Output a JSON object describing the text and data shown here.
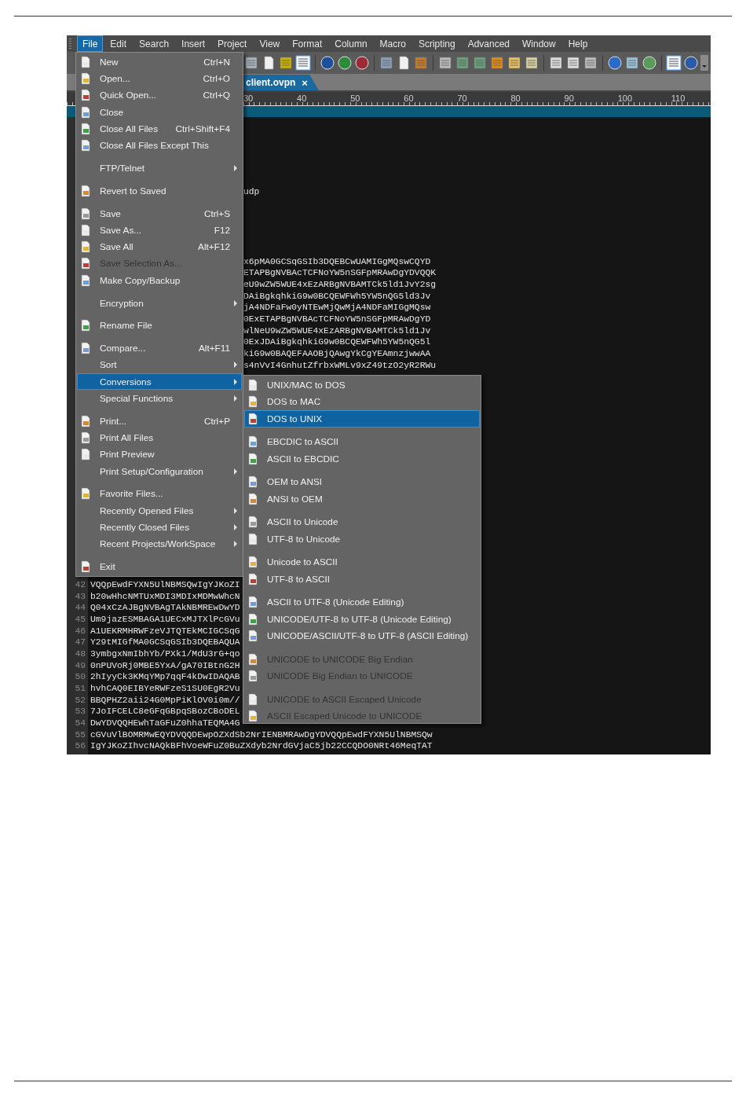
{
  "menubar": [
    {
      "label": "File",
      "selected": true
    },
    {
      "label": "Edit",
      "selected": false
    },
    {
      "label": "Search",
      "selected": false
    },
    {
      "label": "Insert",
      "selected": false
    },
    {
      "label": "Project",
      "selected": false
    },
    {
      "label": "View",
      "selected": false
    },
    {
      "label": "Format",
      "selected": false
    },
    {
      "label": "Column",
      "selected": false
    },
    {
      "label": "Macro",
      "selected": false
    },
    {
      "label": "Scripting",
      "selected": false
    },
    {
      "label": "Advanced",
      "selected": false
    },
    {
      "label": "Window",
      "selected": false
    },
    {
      "label": "Help",
      "selected": false
    }
  ],
  "tabs": [
    {
      "label": "client.ovpn",
      "close": "×",
      "selected": true
    }
  ],
  "ruler": {
    "labels": [
      "30",
      "40",
      "50",
      "60",
      "70",
      "80",
      "90",
      "100",
      "110"
    ]
  },
  "editor": {
    "lines": [
      {
        "kind": "blank"
      },
      {
        "kind": "blank"
      },
      {
        "kind": "blank"
      },
      {
        "kind": "blank"
      },
      {
        "kind": "blank"
      },
      {
        "kind": "blank"
      },
      {
        "kind": "partial",
        "text": "udp"
      },
      {
        "kind": "blank"
      },
      {
        "kind": "blank"
      },
      {
        "kind": "blank"
      },
      {
        "kind": "blank"
      },
      {
        "kind": "blank"
      },
      {
        "kind": "partial",
        "text": "x6pMA0GCSqGSIb3DQEBCwUAMIGgMQswCQYD"
      },
      {
        "kind": "partial",
        "text": "ETAPBgNVBAcTCFNoYW5nSGFpMRAwDgYDVQQK"
      },
      {
        "kind": "partial",
        "text": "eU9wZW5WUE4xEzARBgNVBAMTCk5ld1JvY2sg"
      },
      {
        "kind": "partial",
        "text": "DAiBgkqhkiG9w0BCQEWFWh5YW5nQG5ld3Jv"
      },
      {
        "kind": "partial",
        "text": "jA4NDFaFw0yNTEwMjQwMjA4NDFaMIGgMQsw"
      },
      {
        "kind": "partial",
        "text": "0ExETAPBgNVBAcTCFNoYW5nSGFpMRAwDgYD"
      },
      {
        "kind": "partial",
        "text": "wlNeU9wZW5WUE4xEzARBgNVBAMTCk5ld1Jv"
      },
      {
        "kind": "partial",
        "text": "0ExJDAiBgkqhkiG9w0BCQEWFWh5YW5nQG5l"
      },
      {
        "kind": "partial",
        "text": "kiG9w0BAQEFAAOBjQAwgYkCgYEAmnzjwwAA"
      },
      {
        "kind": "partial",
        "text": "s4nVvI4GnhutZfrbxWMLv9xZ49tzO2yR2RWu"
      },
      {
        "kind": "blank"
      },
      {
        "kind": "blank"
      },
      {
        "kind": "blank"
      },
      {
        "kind": "blank"
      },
      {
        "kind": "blank"
      },
      {
        "kind": "blank"
      },
      {
        "kind": "blank"
      },
      {
        "kind": "blank"
      },
      {
        "kind": "blank"
      },
      {
        "kind": "blank"
      },
      {
        "kind": "blank"
      },
      {
        "kind": "blank"
      },
      {
        "kind": "blank"
      },
      {
        "kind": "blank"
      },
      {
        "kind": "blank"
      },
      {
        "kind": "blank"
      },
      {
        "kind": "blank"
      },
      {
        "kind": "blank"
      },
      {
        "kind": "numbered",
        "number": "42",
        "text": "VQQpEwdFYXN5UlNBMSQwIgYJKoZI"
      },
      {
        "kind": "numbered",
        "number": "43",
        "text": "b20wHhcNMTUxMDI3MDIxMDMwWhcN"
      },
      {
        "kind": "numbered",
        "number": "44",
        "text": "Q04xCzAJBgNVBAgTAkNBMREwDwYD"
      },
      {
        "kind": "numbered",
        "number": "45",
        "text": "Um9jazESMBAGA1UECxMJTXlPcGVu"
      },
      {
        "kind": "numbered",
        "number": "46",
        "text": "A1UEKRMHRWFzeVJTQTEkMCIGCSqG"
      },
      {
        "kind": "numbered",
        "number": "47",
        "text": "Y29tMIGfMA0GCSqGSIb3DQEBAQUA"
      },
      {
        "kind": "numbered",
        "number": "48",
        "text": "3ymbgxNmIbhYb/PXk1/MdU3rG+qo"
      },
      {
        "kind": "numbered",
        "number": "49",
        "text": "0nPUVoRj0MBE5YxA/gA70IBtnG2H"
      },
      {
        "kind": "numbered",
        "number": "50",
        "text": "2hIyyCk3KMqYMp7qqF4kDwIDAQAB"
      },
      {
        "kind": "numbered",
        "number": "51",
        "text": "hvhCAQ0EIBYeRWFzeS1SU0EgR2Vu"
      },
      {
        "kind": "numbered",
        "number": "52",
        "text": "BBQPHZ2aii24G0MpPiKlOV0i0m//"
      },
      {
        "kind": "numbered",
        "number": "53",
        "text": "7JoIFCELC8eGFqGBpqSBozCBoDEL"
      },
      {
        "kind": "numbered",
        "number": "54",
        "text": "DwYDVQQHEwhTaGFuZ0hhaTEQMA4G"
      },
      {
        "kind": "numbered",
        "number": "55",
        "text": "cGVuVlBOMRMwEQYDVQQDEwpOZXdSb2NrIENBMRAwDgYDVQQpEwdFYXN5UlNBMSQw"
      },
      {
        "kind": "numbered",
        "number": "56",
        "text": "IgYJKoZIhvcNAQkBFhVoeWFuZ0BuZXdyb2NrdGVjaC5jb22CCQDO0NRt46MeqTAT"
      }
    ]
  },
  "file_menu": {
    "items": [
      {
        "kind": "item",
        "label": "New",
        "shortcut": "Ctrl+N",
        "icon": true,
        "submenu": false,
        "disabled": false,
        "selected": false
      },
      {
        "kind": "item",
        "label": "Open...",
        "shortcut": "Ctrl+O",
        "icon": true,
        "submenu": false,
        "disabled": false,
        "selected": false
      },
      {
        "kind": "item",
        "label": "Quick Open...",
        "shortcut": "Ctrl+Q",
        "icon": true,
        "submenu": false,
        "disabled": false,
        "selected": false
      },
      {
        "kind": "item",
        "label": "Close",
        "icon": true,
        "submenu": false,
        "disabled": false,
        "selected": false
      },
      {
        "kind": "item",
        "label": "Close All Files",
        "shortcut": "Ctrl+Shift+F4",
        "icon": true,
        "submenu": false,
        "disabled": false,
        "selected": false
      },
      {
        "kind": "item",
        "label": "Close All Files Except This",
        "icon": true,
        "submenu": false,
        "disabled": false,
        "selected": false
      },
      {
        "kind": "separator"
      },
      {
        "kind": "item",
        "label": "FTP/Telnet",
        "icon": false,
        "submenu": true,
        "disabled": false,
        "selected": false
      },
      {
        "kind": "separator"
      },
      {
        "kind": "item",
        "label": "Revert to Saved",
        "icon": true,
        "submenu": false,
        "disabled": false,
        "selected": false
      },
      {
        "kind": "separator"
      },
      {
        "kind": "item",
        "label": "Save",
        "shortcut": "Ctrl+S",
        "icon": true,
        "submenu": false,
        "disabled": false,
        "selected": false
      },
      {
        "kind": "item",
        "label": "Save As...",
        "shortcut": "F12",
        "icon": true,
        "submenu": false,
        "disabled": false,
        "selected": false
      },
      {
        "kind": "item",
        "label": "Save All",
        "shortcut": "Alt+F12",
        "icon": true,
        "submenu": false,
        "disabled": false,
        "selected": false
      },
      {
        "kind": "item",
        "label": "Save Selection As...",
        "icon": true,
        "submenu": false,
        "disabled": true,
        "selected": false
      },
      {
        "kind": "item",
        "label": "Make Copy/Backup",
        "icon": true,
        "submenu": false,
        "disabled": false,
        "selected": false
      },
      {
        "kind": "separator"
      },
      {
        "kind": "item",
        "label": "Encryption",
        "icon": false,
        "submenu": true,
        "disabled": false,
        "selected": false
      },
      {
        "kind": "separator"
      },
      {
        "kind": "item",
        "label": "Rename File",
        "icon": true,
        "submenu": false,
        "disabled": false,
        "selected": false
      },
      {
        "kind": "separator"
      },
      {
        "kind": "item",
        "label": "Compare...",
        "shortcut": "Alt+F11",
        "icon": true,
        "submenu": false,
        "disabled": false,
        "selected": false
      },
      {
        "kind": "item",
        "label": "Sort",
        "icon": false,
        "submenu": true,
        "disabled": false,
        "selected": false
      },
      {
        "kind": "item",
        "label": "Conversions",
        "icon": false,
        "submenu": true,
        "disabled": false,
        "selected": true
      },
      {
        "kind": "item",
        "label": "Special Functions",
        "icon": false,
        "submenu": true,
        "disabled": false,
        "selected": false
      },
      {
        "kind": "separator"
      },
      {
        "kind": "item",
        "label": "Print...",
        "shortcut": "Ctrl+P",
        "icon": true,
        "submenu": false,
        "disabled": false,
        "selected": false
      },
      {
        "kind": "item",
        "label": "Print All Files",
        "icon": true,
        "submenu": false,
        "disabled": false,
        "selected": false
      },
      {
        "kind": "item",
        "label": "Print Preview",
        "icon": true,
        "submenu": false,
        "disabled": false,
        "selected": false
      },
      {
        "kind": "item",
        "label": "Print Setup/Configuration",
        "icon": false,
        "submenu": true,
        "disabled": false,
        "selected": false
      },
      {
        "kind": "separator"
      },
      {
        "kind": "item",
        "label": "Favorite Files...",
        "icon": true,
        "submenu": false,
        "disabled": false,
        "selected": false
      },
      {
        "kind": "item",
        "label": "Recently Opened Files",
        "icon": false,
        "submenu": true,
        "disabled": false,
        "selected": false
      },
      {
        "kind": "item",
        "label": "Recently Closed Files",
        "icon": false,
        "submenu": true,
        "disabled": false,
        "selected": false
      },
      {
        "kind": "item",
        "label": "Recent Projects/WorkSpace",
        "icon": false,
        "submenu": true,
        "disabled": false,
        "selected": false
      },
      {
        "kind": "separator"
      },
      {
        "kind": "item",
        "label": "Exit",
        "icon": true,
        "submenu": false,
        "disabled": false,
        "selected": false
      }
    ]
  },
  "conversions_menu": {
    "items": [
      {
        "kind": "item",
        "label": "UNIX/MAC to DOS",
        "icon": true,
        "submenu": false,
        "disabled": false,
        "selected": false
      },
      {
        "kind": "item",
        "label": "DOS to MAC",
        "icon": true,
        "submenu": false,
        "disabled": false,
        "selected": false
      },
      {
        "kind": "item",
        "label": "DOS to UNIX",
        "icon": true,
        "submenu": false,
        "disabled": false,
        "selected": true
      },
      {
        "kind": "separator"
      },
      {
        "kind": "item",
        "label": "EBCDIC to ASCII",
        "icon": true,
        "submenu": false,
        "disabled": false,
        "selected": false
      },
      {
        "kind": "item",
        "label": "ASCII to EBCDIC",
        "icon": true,
        "submenu": false,
        "disabled": false,
        "selected": false
      },
      {
        "kind": "separator"
      },
      {
        "kind": "item",
        "label": "OEM to ANSI",
        "icon": true,
        "submenu": false,
        "disabled": false,
        "selected": false
      },
      {
        "kind": "item",
        "label": "ANSI to OEM",
        "icon": true,
        "submenu": false,
        "disabled": false,
        "selected": false
      },
      {
        "kind": "separator"
      },
      {
        "kind": "item",
        "label": "ASCII to Unicode",
        "icon": true,
        "submenu": false,
        "disabled": false,
        "selected": false
      },
      {
        "kind": "item",
        "label": "UTF-8 to Unicode",
        "icon": true,
        "submenu": false,
        "disabled": false,
        "selected": false
      },
      {
        "kind": "separator"
      },
      {
        "kind": "item",
        "label": "Unicode to ASCII",
        "icon": true,
        "submenu": false,
        "disabled": false,
        "selected": false
      },
      {
        "kind": "item",
        "label": "UTF-8 to ASCII",
        "icon": true,
        "submenu": false,
        "disabled": false,
        "selected": false
      },
      {
        "kind": "separator"
      },
      {
        "kind": "item",
        "label": "ASCII to UTF-8 (Unicode Editing)",
        "icon": true,
        "submenu": false,
        "disabled": false,
        "selected": false
      },
      {
        "kind": "item",
        "label": "UNICODE/UTF-8 to UTF-8 (Unicode Editing)",
        "icon": true,
        "submenu": false,
        "disabled": false,
        "selected": false
      },
      {
        "kind": "item",
        "label": "UNICODE/ASCII/UTF-8 to UTF-8 (ASCII Editing)",
        "icon": true,
        "submenu": false,
        "disabled": false,
        "selected": false
      },
      {
        "kind": "separator"
      },
      {
        "kind": "item",
        "label": "UNICODE to UNICODE Big Endian",
        "icon": true,
        "submenu": false,
        "disabled": true,
        "selected": false
      },
      {
        "kind": "item",
        "label": "UNICODE Big Endian to UNICODE",
        "icon": true,
        "submenu": false,
        "disabled": true,
        "selected": false
      },
      {
        "kind": "separator"
      },
      {
        "kind": "item",
        "label": "UNICODE to ASCII Escaped Unicode",
        "icon": true,
        "submenu": false,
        "disabled": true,
        "selected": false
      },
      {
        "kind": "item",
        "label": "ASCII Escaped Unicode to UNICODE",
        "icon": true,
        "submenu": false,
        "disabled": true,
        "selected": false
      }
    ]
  }
}
